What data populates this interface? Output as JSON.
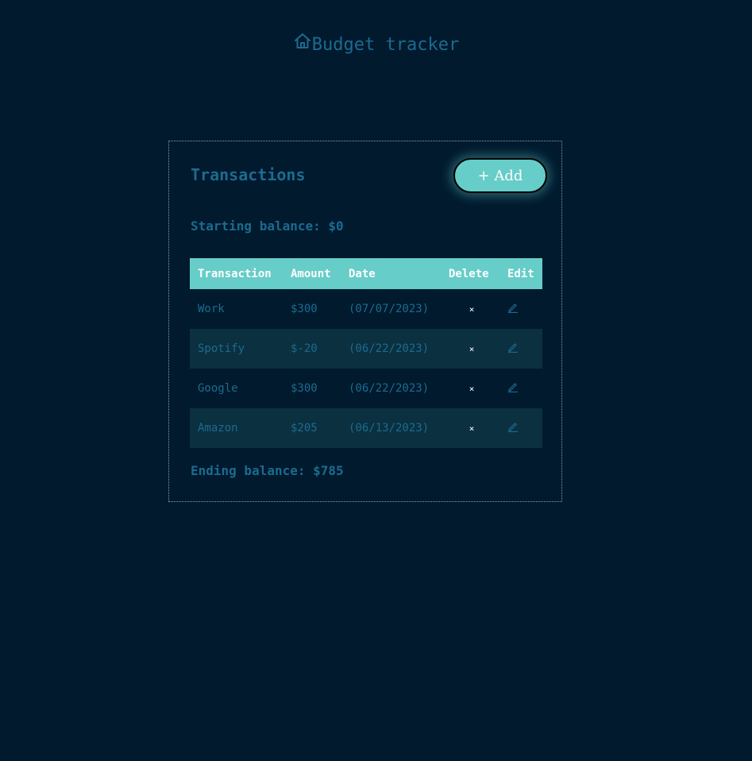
{
  "header": {
    "title": "Budget tracker",
    "icon": "home-icon"
  },
  "card": {
    "title": "Transactions",
    "add_button_label": "+ Add",
    "starting_balance": "Starting balance: $0",
    "ending_balance": "Ending balance: $785"
  },
  "table": {
    "headers": [
      "Transaction",
      "Amount",
      "Date",
      "Delete",
      "Edit"
    ],
    "rows": [
      {
        "name": "Work",
        "amount": "$300",
        "date": "(07/07/2023)",
        "delete": "×",
        "edit_icon": "pencil-icon"
      },
      {
        "name": "Spotify",
        "amount": "$-20",
        "date": "(06/22/2023)",
        "delete": "×",
        "edit_icon": "pencil-icon"
      },
      {
        "name": "Google",
        "amount": "$300",
        "date": "(06/22/2023)",
        "delete": "×",
        "edit_icon": "pencil-icon"
      },
      {
        "name": "Amazon",
        "amount": "$205",
        "date": "(06/13/2023)",
        "delete": "×",
        "edit_icon": "pencil-icon"
      }
    ]
  },
  "colors": {
    "background": "#011a2e",
    "accent": "#66cdc8",
    "text": "#1c6b8f",
    "positive": "#008000",
    "negative": "#ff0000",
    "row_alt": "#0b3040"
  }
}
